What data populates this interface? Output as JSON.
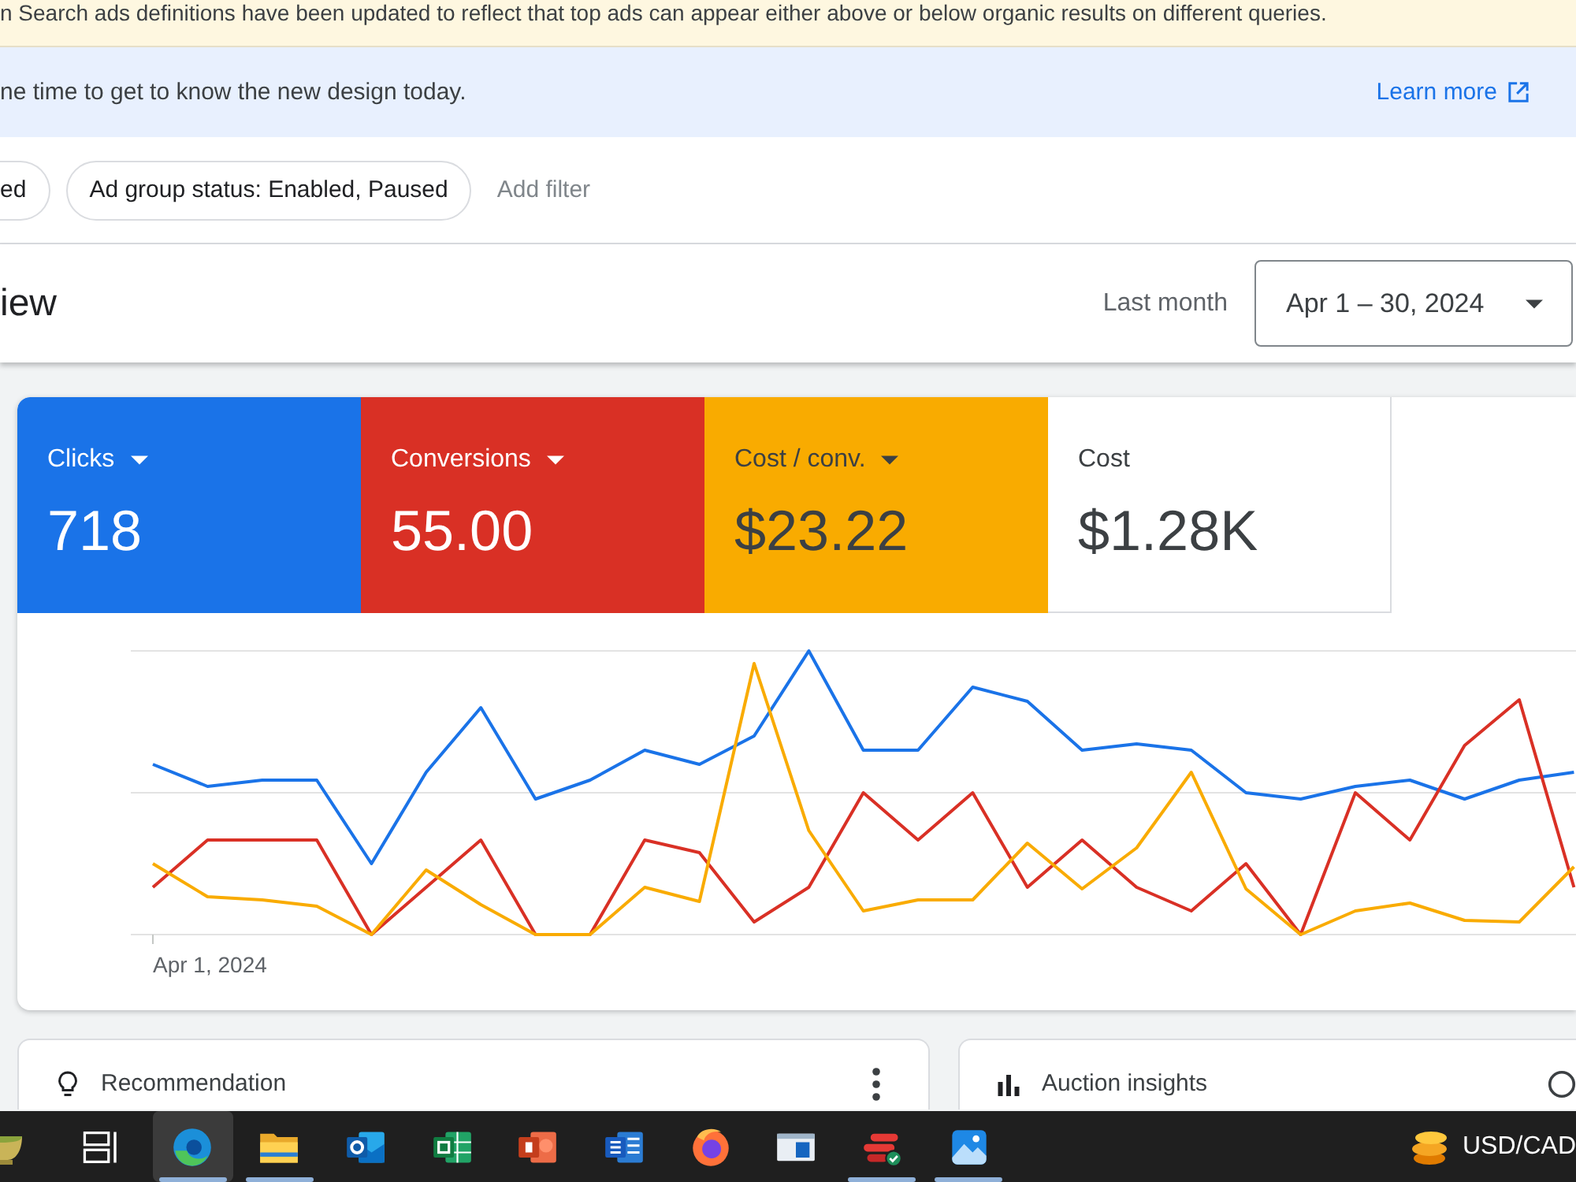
{
  "notice_banner": {
    "text": "n Search ads definitions have been updated to reflect that top ads can appear either above or below organic results on different queries."
  },
  "info_banner": {
    "text": "ne time to get to know the new design today.",
    "link": "Learn more"
  },
  "filters": {
    "chips": [
      "ed",
      "Ad group status: Enabled, Paused"
    ],
    "add_filter": "Add filter"
  },
  "header": {
    "title": "iew",
    "date_preset": "Last month",
    "date_range": "Apr 1 – 30, 2024"
  },
  "metrics": [
    {
      "label": "Clicks",
      "value": "718",
      "selected": true,
      "color": "#1a73e8"
    },
    {
      "label": "Conversions",
      "value": "55.00",
      "selected": true,
      "color": "#d93025"
    },
    {
      "label": "Cost / conv.",
      "value": "$23.22",
      "selected": true,
      "color": "#f9ab00"
    },
    {
      "label": "Cost",
      "value": "$1.28K",
      "selected": false
    }
  ],
  "chart": {
    "x_label": "Apr 1, 2024"
  },
  "cards": [
    {
      "kind": "recommendation",
      "title": "Recommendation"
    },
    {
      "kind": "auction",
      "title": "Auction insights"
    }
  ],
  "taskbar": {
    "apps": [
      {
        "kind": "taskview",
        "selected": false,
        "running": false
      },
      {
        "kind": "swirl",
        "selected": true,
        "running": true
      },
      {
        "kind": "folder",
        "selected": false,
        "running": true
      },
      {
        "kind": "mail",
        "selected": false,
        "running": false
      },
      {
        "kind": "sheet",
        "selected": false,
        "running": false
      },
      {
        "kind": "slides",
        "selected": false,
        "running": false
      },
      {
        "kind": "doc",
        "selected": false,
        "running": false
      },
      {
        "kind": "fox",
        "selected": false,
        "running": false
      },
      {
        "kind": "window",
        "selected": false,
        "running": false
      },
      {
        "kind": "stripes",
        "selected": false,
        "running": true
      },
      {
        "kind": "picture",
        "selected": false,
        "running": true
      }
    ],
    "tray_label": "USD/CAD"
  }
}
